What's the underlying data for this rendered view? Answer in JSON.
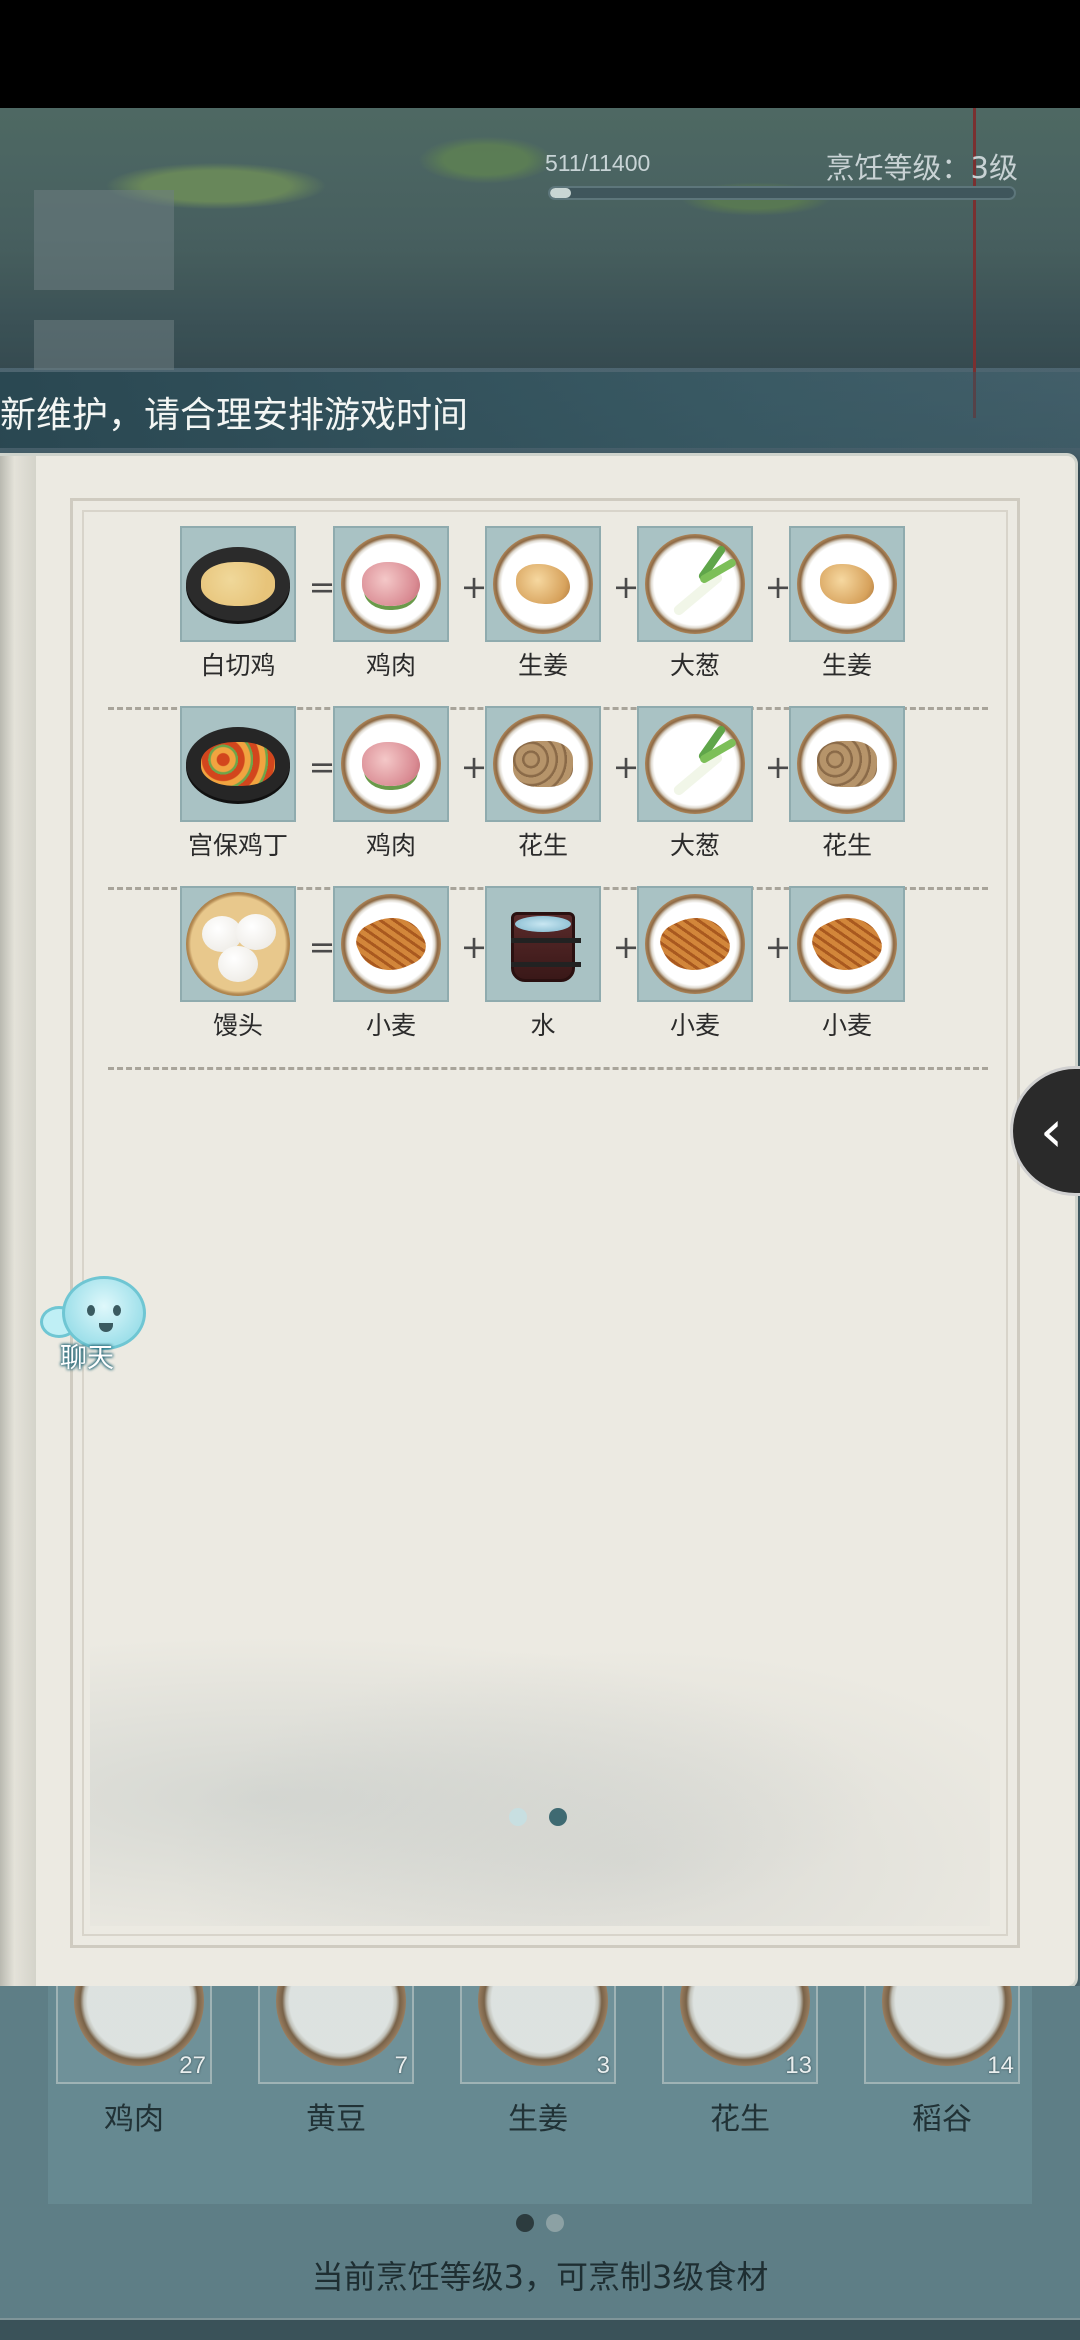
{
  "header": {
    "exp_text": "511/11400",
    "exp_progress": 0.045,
    "level_text": "烹饪等级：3级"
  },
  "notice": {
    "text": "新维护，请合理安排游戏时间"
  },
  "recipes": [
    {
      "result": {
        "name": "白切鸡",
        "icon": "white-cut-chicken-icon"
      },
      "ingredients": [
        {
          "name": "鸡肉",
          "icon": "chicken-meat-icon"
        },
        {
          "name": "生姜",
          "icon": "ginger-icon"
        },
        {
          "name": "大葱",
          "icon": "scallion-icon"
        },
        {
          "name": "生姜",
          "icon": "ginger-icon"
        }
      ]
    },
    {
      "result": {
        "name": "宫保鸡丁",
        "icon": "kung-pao-chicken-icon"
      },
      "ingredients": [
        {
          "name": "鸡肉",
          "icon": "chicken-meat-icon"
        },
        {
          "name": "花生",
          "icon": "peanut-icon"
        },
        {
          "name": "大葱",
          "icon": "scallion-icon"
        },
        {
          "name": "花生",
          "icon": "peanut-icon"
        }
      ]
    },
    {
      "result": {
        "name": "馒头",
        "icon": "steamed-bun-icon"
      },
      "ingredients": [
        {
          "name": "小麦",
          "icon": "wheat-icon"
        },
        {
          "name": "水",
          "icon": "water-bucket-icon"
        },
        {
          "name": "小麦",
          "icon": "wheat-icon"
        },
        {
          "name": "小麦",
          "icon": "wheat-icon"
        }
      ]
    }
  ],
  "operators": {
    "equals": "=",
    "plus": "+"
  },
  "book_pages": {
    "current": 2,
    "total": 2
  },
  "chat": {
    "label": "聊天",
    "icon": "chat-bubble-icon"
  },
  "side_toggle": {
    "icon": "chevron-left-icon",
    "glyph": "‹"
  },
  "inventory": {
    "items": [
      {
        "name": "鸡肉",
        "count": "27",
        "icon": "chicken-meat-icon"
      },
      {
        "name": "黄豆",
        "count": "7",
        "icon": "soybean-icon"
      },
      {
        "name": "生姜",
        "count": "3",
        "icon": "ginger-icon"
      },
      {
        "name": "花生",
        "count": "13",
        "icon": "peanut-icon"
      },
      {
        "name": "稻谷",
        "count": "14",
        "icon": "rice-grain-icon"
      }
    ],
    "page": {
      "current": 1,
      "total": 2
    },
    "footer": "当前烹饪等级3，可烹制3级食材"
  },
  "colors": {
    "tile_bg": "#a9c2c4",
    "page_bg": "#eceae2",
    "inventory_bg": "#5e7e86",
    "dot_active": "#3f6a72"
  }
}
